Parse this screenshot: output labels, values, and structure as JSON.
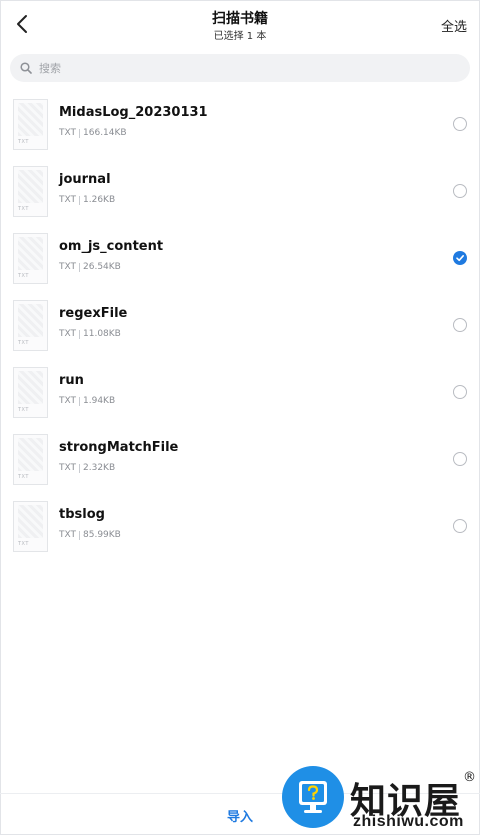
{
  "header": {
    "title": "扫描书籍",
    "subtitle": "已选择 1 本",
    "select_all": "全选",
    "back_icon": "chevron-left-icon"
  },
  "search": {
    "placeholder": "搜索",
    "value": "",
    "icon": "search-icon"
  },
  "files": [
    {
      "name": "MidasLog_20230131",
      "type": "TXT",
      "size": "166.14KB",
      "selected": false
    },
    {
      "name": "journal",
      "type": "TXT",
      "size": "1.26KB",
      "selected": false
    },
    {
      "name": "om_js_content",
      "type": "TXT",
      "size": "26.54KB",
      "selected": true
    },
    {
      "name": "regexFile",
      "type": "TXT",
      "size": "11.08KB",
      "selected": false
    },
    {
      "name": "run",
      "type": "TXT",
      "size": "1.94KB",
      "selected": false
    },
    {
      "name": "strongMatchFile",
      "type": "TXT",
      "size": "2.32KB",
      "selected": false
    },
    {
      "name": "tbslog",
      "type": "TXT",
      "size": "85.99KB",
      "selected": false
    }
  ],
  "footer": {
    "import_label": "导入"
  },
  "watermark": {
    "brand": "知识屋",
    "reg_mark": "®",
    "domain": "zhishiwu.com"
  },
  "colors": {
    "accent": "#1f7ae0",
    "watermark_badge": "#1f8fe6"
  }
}
